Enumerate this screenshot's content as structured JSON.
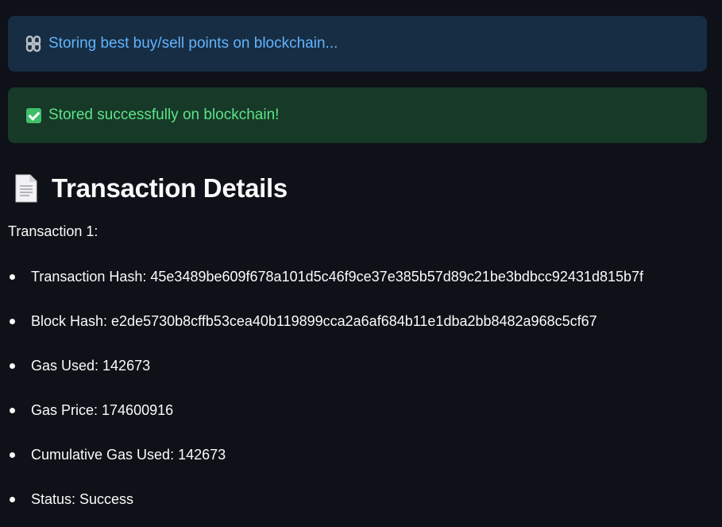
{
  "alerts": {
    "info": {
      "icon": "chain-link-icon",
      "text": "Storing best buy/sell points on blockchain..."
    },
    "success": {
      "icon": "check-mark-icon",
      "text": "Stored successfully on blockchain!"
    }
  },
  "section": {
    "icon": "document-icon",
    "title": "Transaction Details"
  },
  "transaction": {
    "label": "Transaction 1:",
    "fields": [
      "Transaction Hash: 45e3489be609f678a101d5c46f9ce37e385b57d89c21be3bdbcc92431d815b7f",
      "Block Hash: e2de5730b8cffb53cea40b119899cca2a6af684b11e1dba2bb8482a968c5cf67",
      "Gas Used: 142673",
      "Gas Price: 174600916",
      "Cumulative Gas Used: 142673",
      "Status: Success"
    ]
  },
  "colors": {
    "background": "#0e1117",
    "info_bg": "#172d43",
    "info_text": "#60b4ff",
    "success_bg": "#173928",
    "success_text": "#5ce488",
    "text": "#fafafa"
  }
}
